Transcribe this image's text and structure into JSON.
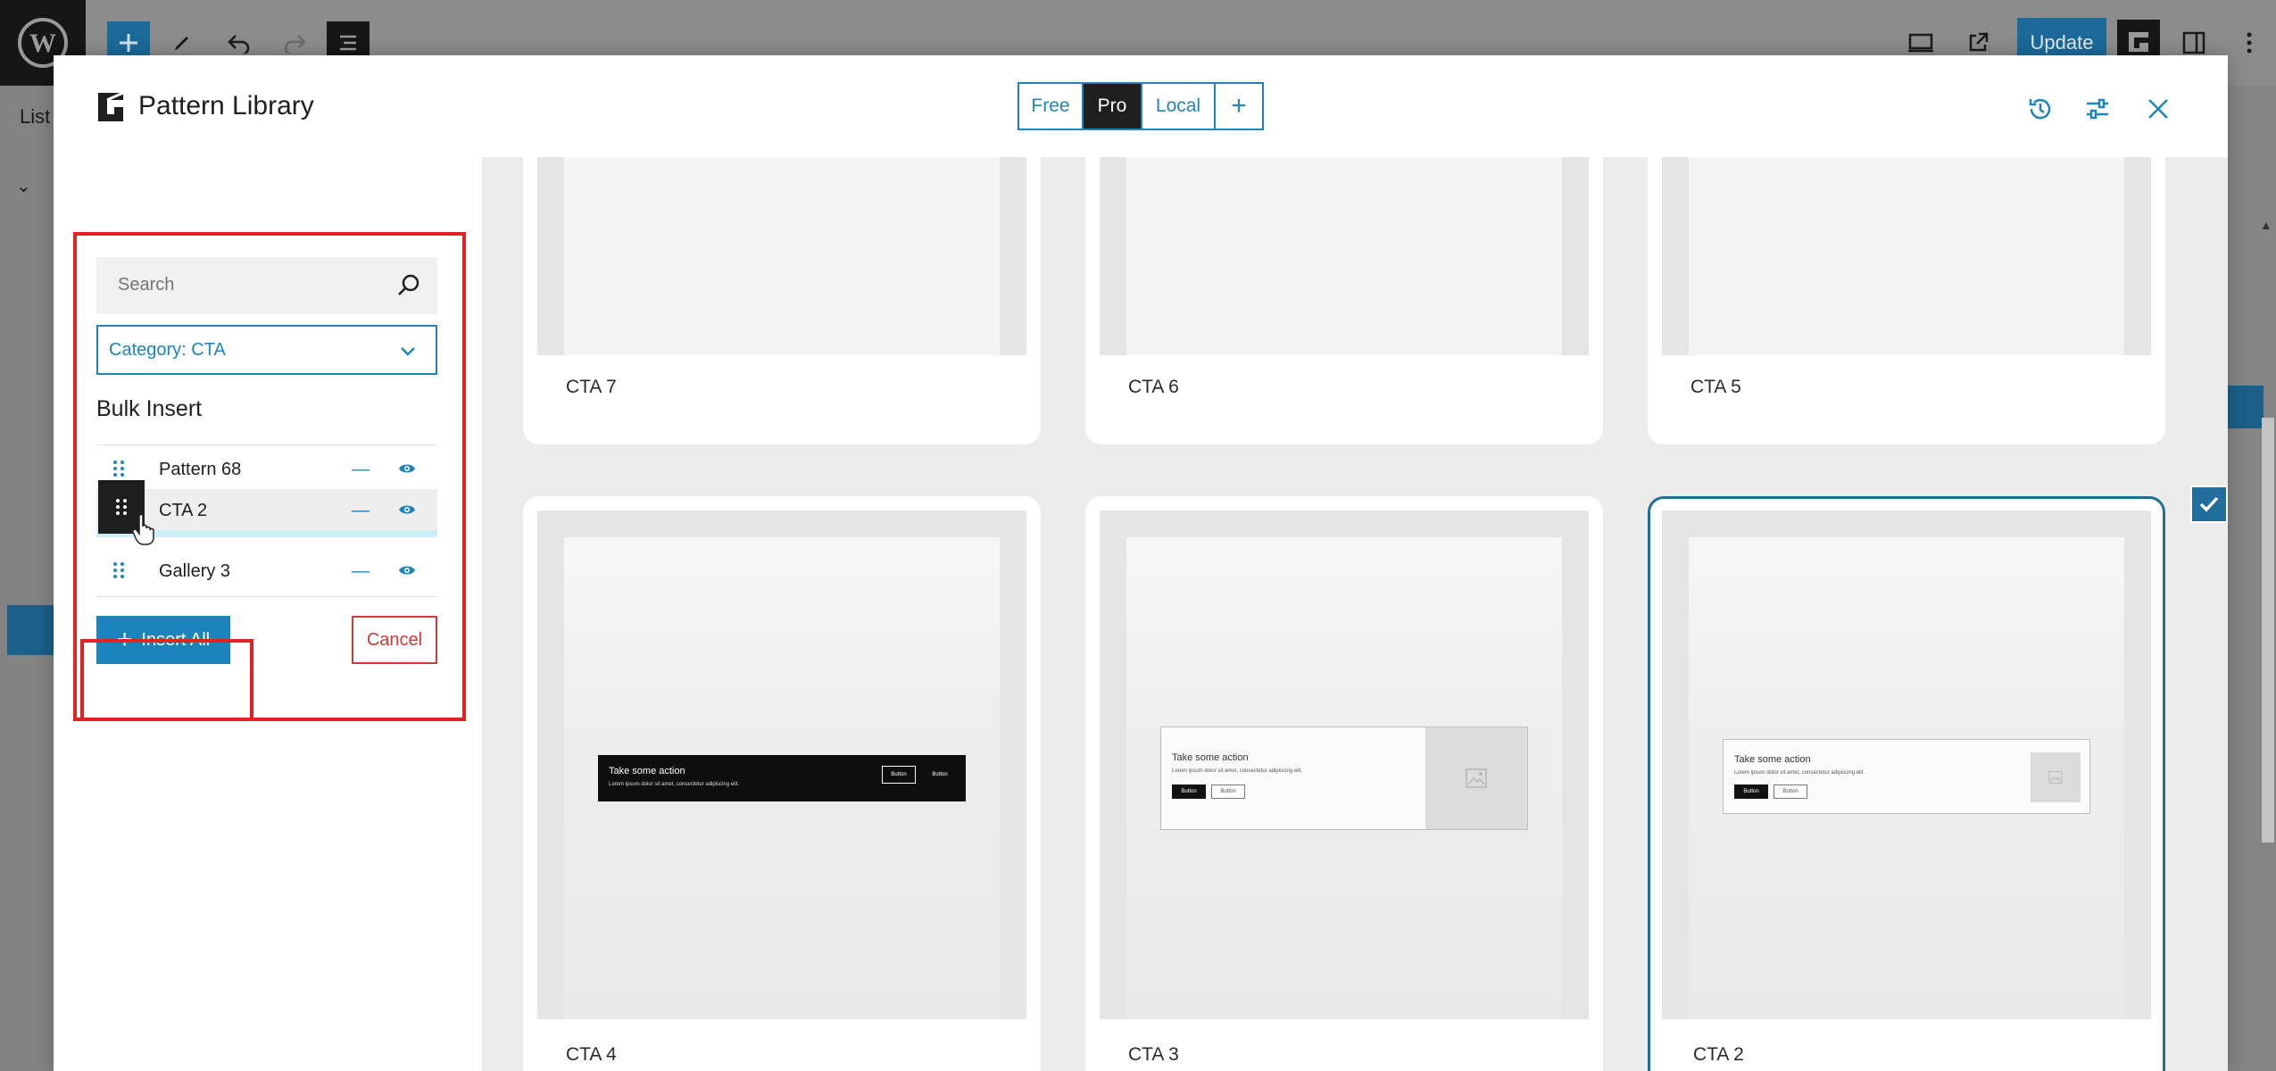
{
  "editor": {
    "list_label": "List",
    "update_label": "Update"
  },
  "modal": {
    "title": "Pattern Library",
    "tabs": [
      {
        "label": "Free",
        "active": false
      },
      {
        "label": "Pro",
        "active": true
      },
      {
        "label": "Local",
        "active": false
      },
      {
        "label": "+",
        "active": false
      }
    ]
  },
  "sidebar": {
    "search": {
      "placeholder": "Search"
    },
    "category_select": {
      "value": "Category: CTA"
    },
    "bulk_insert_title": "Bulk Insert",
    "bulk_items": [
      {
        "label": "Pattern 68",
        "selected": false
      },
      {
        "label": "CTA 2",
        "selected": true
      },
      {
        "label": "Gallery 3",
        "selected": false
      }
    ],
    "insert_all_label": "Insert All",
    "cancel_label": "Cancel"
  },
  "patterns": [
    {
      "label": "CTA 7",
      "selected": false
    },
    {
      "label": "CTA 6",
      "selected": false
    },
    {
      "label": "CTA 5",
      "selected": false
    },
    {
      "label": "CTA 4",
      "selected": false
    },
    {
      "label": "CTA 3",
      "selected": false
    },
    {
      "label": "CTA 2",
      "selected": true
    }
  ],
  "preview": {
    "heading": "Take some action",
    "subtext": "Lorem ipsum dolor sit amet, consectetur adipiscing elit.",
    "button1": "Button",
    "button2": "Button"
  },
  "colors": {
    "accent": "#1f84b8",
    "selected_border": "#1f6e9c",
    "highlight_red": "#e3231f",
    "cancel_red": "#cc3a3a",
    "dark": "#1e1e1e"
  }
}
